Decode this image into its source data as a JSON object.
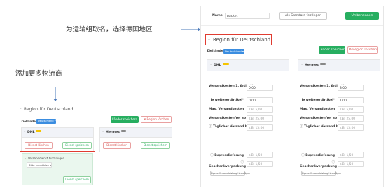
{
  "annotations": {
    "name_note": "为运输组取名，选择德国地区",
    "add_note": "添加更多物流商"
  },
  "colors": {
    "accent_green": "#27ae60",
    "accent_blue": "#3b8de0",
    "danger_red": "#d9534f",
    "highlight_red": "#e03c31",
    "dhl_yellow": "#f5c400",
    "annotation_arrow": "#4a78b8"
  },
  "right_panel": {
    "top_bar": {
      "name_label": "Name",
      "name_value": "packet",
      "default_button": "Als Standard festlegen",
      "rename_button": "Umbenennen"
    },
    "region_title": "Region für Deutschland",
    "zielländer_label": "Zielländer",
    "zielländer_value": "Deutschland",
    "save_countries_button": "Länder speichern",
    "delete_region_button": "Region löschen",
    "carriers": [
      {
        "name": "DHL",
        "fields": [
          {
            "label": "Versandkosten 1. Artikel*",
            "value": "0,00",
            "placeholder": ""
          },
          {
            "label": "Je weiterer Artikel*",
            "value": "0,00",
            "placeholder": ""
          },
          {
            "label": "Max. Versandkosten",
            "value": "",
            "placeholder": "z.B. 5,00"
          },
          {
            "label": "Versandkostenfrei ab",
            "value": "",
            "placeholder": "z.B. 25,00"
          },
          {
            "label": "Täglicher Versand bis",
            "value": "",
            "placeholder": "z.B. 13:00"
          }
        ],
        "express_label": "Expresslieferung",
        "express_placeholder": "z.B. 1,50",
        "gift_label": "Geschenkverpackung",
        "gift_placeholder": "z.B. 1,50",
        "add_own_button": "Eigene Versandleistung hinzufügen"
      },
      {
        "name": "Hermes",
        "fields": [
          {
            "label": "Versandkosten 1. Artikel*",
            "value": "3,00",
            "placeholder": ""
          },
          {
            "label": "Je weiterer Artikel*",
            "value": "1,00",
            "placeholder": ""
          },
          {
            "label": "Max. Versandkosten",
            "value": "",
            "placeholder": "z.B. 5,00"
          },
          {
            "label": "Versandkostenfrei ab",
            "value": "",
            "placeholder": "z.B. 25,00"
          },
          {
            "label": "Täglicher Versand bis",
            "value": "",
            "placeholder": "z.B. 13:00"
          }
        ],
        "express_label": "Expresslieferung",
        "express_placeholder": "z.B. 1,50",
        "gift_label": "Geschenkverpackung",
        "gift_placeholder": "z.B. 1,50",
        "add_own_button": "Eigene Versandleistung hinzufügen"
      }
    ]
  },
  "left_panel": {
    "region_title": "Region für Deutschland",
    "zielländer_label": "Zielländer",
    "zielländer_value": "Deutschland",
    "save_countries_button": "Länder speichern",
    "delete_region_button": "Region löschen",
    "carriers": [
      {
        "name": "DHL",
        "delete_button": "Dienst löschen",
        "save_button": "Dienst speichern"
      },
      {
        "name": "Hermes",
        "delete_button": "Dienst löschen",
        "save_button": "Dienst speichern"
      }
    ],
    "add_carrier": {
      "title": "Versanddienst hinzufügen",
      "select_placeholder": "Bitte auswählen",
      "save_button": "Dienst speichern"
    }
  }
}
